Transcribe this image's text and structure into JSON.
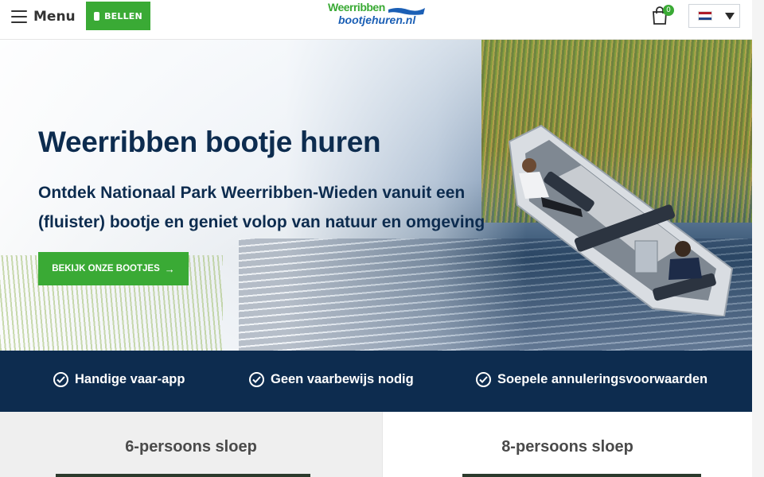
{
  "header": {
    "menu_label": "Menu",
    "call_label": "BELLEN",
    "logo_top": "Weerribben",
    "logo_bottom": "bootjehuren.nl",
    "cart_count": "0",
    "language": "nl",
    "colors": {
      "brand_green": "#3aaa35",
      "brand_blue": "#1b5fb5",
      "navy": "#0d2c4f"
    }
  },
  "hero": {
    "title": "Weerribben bootje huren",
    "subtitle": "Ontdek Nationaal Park Weerribben-Wieden vanuit een (fluister) bootje en geniet volop van natuur en omgeving",
    "button_label": "BEKIJK ONZE BOOTJES",
    "button_icon": "arrow-right-icon"
  },
  "usps": [
    {
      "label": "Handige vaar-app",
      "icon": "check-circle-icon"
    },
    {
      "label": "Geen vaarbewijs nodig",
      "icon": "check-circle-icon"
    },
    {
      "label": "Soepele annuleringsvoorwaarden",
      "icon": "check-circle-icon"
    }
  ],
  "products": [
    {
      "title": "6-persoons sloep"
    },
    {
      "title": "8-persoons sloep"
    }
  ]
}
